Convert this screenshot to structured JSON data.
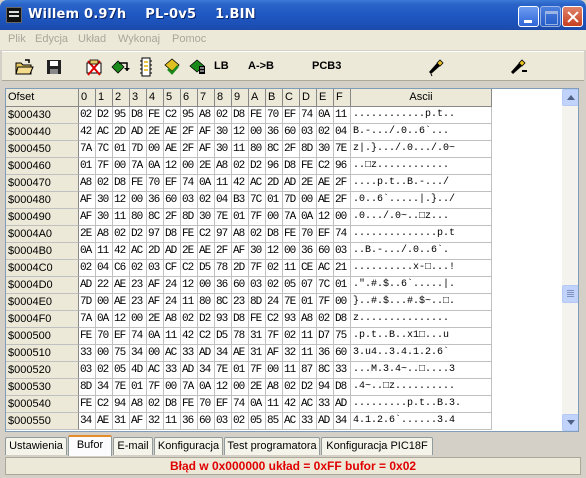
{
  "window": {
    "title": "Willem 0.97h    PL-0v5    1.BIN"
  },
  "menu": [
    "Plik",
    "Edycja",
    "Układ",
    "Wykonaj",
    "Pomoc"
  ],
  "toolbar": {
    "lb_label": "LB",
    "ab_label": "A->B",
    "pcb_label": "PCB3",
    "icons": [
      "open-folder-icon",
      "save-disk-icon",
      "erase-chip-icon",
      "read-chip-icon",
      "blank-check-icon",
      "program-chip-icon",
      "verify-chip-icon",
      "settings-tool-icon",
      "config-tool-icon"
    ]
  },
  "grid": {
    "headers": [
      "Ofset",
      "0",
      "1",
      "2",
      "3",
      "4",
      "5",
      "6",
      "7",
      "8",
      "9",
      "A",
      "B",
      "C",
      "D",
      "E",
      "F",
      "Ascii"
    ],
    "rows": [
      {
        "addr": "$000430",
        "bytes": [
          "02",
          "D2",
          "95",
          "D8",
          "FE",
          "C2",
          "95",
          "A8",
          "02",
          "D8",
          "FE",
          "70",
          "EF",
          "74",
          "0A",
          "11"
        ],
        "ascii": "............p.t.."
      },
      {
        "addr": "$000440",
        "bytes": [
          "42",
          "AC",
          "2D",
          "AD",
          "2E",
          "AE",
          "2F",
          "AF",
          "30",
          "12",
          "00",
          "36",
          "60",
          "03",
          "02",
          "04"
        ],
        "ascii": "B.-.../.0..6`..."
      },
      {
        "addr": "$000450",
        "bytes": [
          "7A",
          "7C",
          "01",
          "7D",
          "00",
          "AE",
          "2F",
          "AF",
          "30",
          "11",
          "80",
          "8C",
          "2F",
          "8D",
          "30",
          "7E"
        ],
        "ascii": "z|.}.../.0.../.0~"
      },
      {
        "addr": "$000460",
        "bytes": [
          "01",
          "7F",
          "00",
          "7A",
          "0A",
          "12",
          "00",
          "2E",
          "A8",
          "02",
          "D2",
          "96",
          "D8",
          "FE",
          "C2",
          "96"
        ],
        "ascii": "..□z............"
      },
      {
        "addr": "$000470",
        "bytes": [
          "A8",
          "02",
          "D8",
          "FE",
          "70",
          "EF",
          "74",
          "0A",
          "11",
          "42",
          "AC",
          "2D",
          "AD",
          "2E",
          "AE",
          "2F"
        ],
        "ascii": "....p.t..B.-.../"
      },
      {
        "addr": "$000480",
        "bytes": [
          "AF",
          "30",
          "12",
          "00",
          "36",
          "60",
          "03",
          "02",
          "04",
          "B3",
          "7C",
          "01",
          "7D",
          "00",
          "AE",
          "2F"
        ],
        "ascii": ".0..6`.....|.}../"
      },
      {
        "addr": "$000490",
        "bytes": [
          "AF",
          "30",
          "11",
          "80",
          "8C",
          "2F",
          "8D",
          "30",
          "7E",
          "01",
          "7F",
          "00",
          "7A",
          "0A",
          "12",
          "00"
        ],
        "ascii": ".0.../.0~..□z..."
      },
      {
        "addr": "$0004A0",
        "bytes": [
          "2E",
          "A8",
          "02",
          "D2",
          "97",
          "D8",
          "FE",
          "C2",
          "97",
          "A8",
          "02",
          "D8",
          "FE",
          "70",
          "EF",
          "74"
        ],
        "ascii": "..............p.t"
      },
      {
        "addr": "$0004B0",
        "bytes": [
          "0A",
          "11",
          "42",
          "AC",
          "2D",
          "AD",
          "2E",
          "AE",
          "2F",
          "AF",
          "30",
          "12",
          "00",
          "36",
          "60",
          "03"
        ],
        "ascii": "..B.-.../.0..6`."
      },
      {
        "addr": "$0004C0",
        "bytes": [
          "02",
          "04",
          "C6",
          "02",
          "03",
          "CF",
          "C2",
          "D5",
          "78",
          "2D",
          "7F",
          "02",
          "11",
          "CE",
          "AC",
          "21"
        ],
        "ascii": "..........x-□...!"
      },
      {
        "addr": "$0004D0",
        "bytes": [
          "AD",
          "22",
          "AE",
          "23",
          "AF",
          "24",
          "12",
          "00",
          "36",
          "60",
          "03",
          "02",
          "05",
          "07",
          "7C",
          "01"
        ],
        "ascii": ".\".#.$..6`.....|."
      },
      {
        "addr": "$0004E0",
        "bytes": [
          "7D",
          "00",
          "AE",
          "23",
          "AF",
          "24",
          "11",
          "80",
          "8C",
          "23",
          "8D",
          "24",
          "7E",
          "01",
          "7F",
          "00"
        ],
        "ascii": "}..#.$...#.$~..□."
      },
      {
        "addr": "$0004F0",
        "bytes": [
          "7A",
          "0A",
          "12",
          "00",
          "2E",
          "A8",
          "02",
          "D2",
          "93",
          "D8",
          "FE",
          "C2",
          "93",
          "A8",
          "02",
          "D8"
        ],
        "ascii": "z..............."
      },
      {
        "addr": "$000500",
        "bytes": [
          "FE",
          "70",
          "EF",
          "74",
          "0A",
          "11",
          "42",
          "C2",
          "D5",
          "78",
          "31",
          "7F",
          "02",
          "11",
          "D7",
          "75"
        ],
        "ascii": ".p.t..B..x1□...u"
      },
      {
        "addr": "$000510",
        "bytes": [
          "33",
          "00",
          "75",
          "34",
          "00",
          "AC",
          "33",
          "AD",
          "34",
          "AE",
          "31",
          "AF",
          "32",
          "11",
          "36",
          "60"
        ],
        "ascii": "3.u4..3.4.1.2.6`"
      },
      {
        "addr": "$000520",
        "bytes": [
          "03",
          "02",
          "05",
          "4D",
          "AC",
          "33",
          "AD",
          "34",
          "7E",
          "01",
          "7F",
          "00",
          "11",
          "87",
          "8C",
          "33"
        ],
        "ascii": "...M.3.4~..□....3"
      },
      {
        "addr": "$000530",
        "bytes": [
          "8D",
          "34",
          "7E",
          "01",
          "7F",
          "00",
          "7A",
          "0A",
          "12",
          "00",
          "2E",
          "A8",
          "02",
          "D2",
          "94",
          "D8"
        ],
        "ascii": ".4~..□z.........."
      },
      {
        "addr": "$000540",
        "bytes": [
          "FE",
          "C2",
          "94",
          "A8",
          "02",
          "D8",
          "FE",
          "70",
          "EF",
          "74",
          "0A",
          "11",
          "42",
          "AC",
          "33",
          "AD"
        ],
        "ascii": ".........p.t..B.3."
      },
      {
        "addr": "$000550",
        "bytes": [
          "34",
          "AE",
          "31",
          "AF",
          "32",
          "11",
          "36",
          "60",
          "03",
          "02",
          "05",
          "85",
          "AC",
          "33",
          "AD",
          "34"
        ],
        "ascii": "4.1.2.6`......3.4"
      }
    ]
  },
  "tabs": [
    {
      "label": "Ustawienia",
      "active": false
    },
    {
      "label": "Bufor",
      "active": true
    },
    {
      "label": "E-mail",
      "active": false
    },
    {
      "label": "Konfiguracja",
      "active": false
    },
    {
      "label": "Test programatora",
      "active": false
    },
    {
      "label": "Konfiguracja PIC18F",
      "active": false
    }
  ],
  "status": {
    "text": "Błąd w 0x000000  układ = 0xFF  bufor = 0x02",
    "color": "#e00000"
  }
}
